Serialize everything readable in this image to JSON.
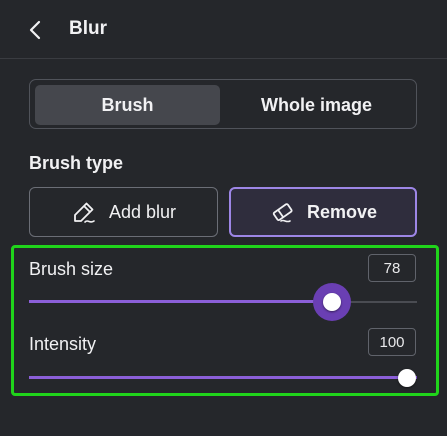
{
  "header": {
    "title": "Blur",
    "back_icon": "chevron-left-icon"
  },
  "mode_tabs": {
    "items": [
      {
        "label": "Brush",
        "selected": true
      },
      {
        "label": "Whole image",
        "selected": false
      }
    ]
  },
  "brush_type": {
    "title": "Brush type",
    "options": [
      {
        "label": "Add blur",
        "icon": "brush-pen-icon",
        "selected": false
      },
      {
        "label": "Remove",
        "icon": "eraser-icon",
        "selected": true
      }
    ]
  },
  "controls": {
    "brush_size": {
      "label": "Brush size",
      "value": "78",
      "fraction": 0.78
    },
    "intensity": {
      "label": "Intensity",
      "value": "100",
      "fraction": 1.0
    }
  },
  "colors": {
    "accent": "#8b5fd8",
    "selected_border": "#9d86e6",
    "highlight": "#20d41b",
    "background": "#25272b"
  }
}
